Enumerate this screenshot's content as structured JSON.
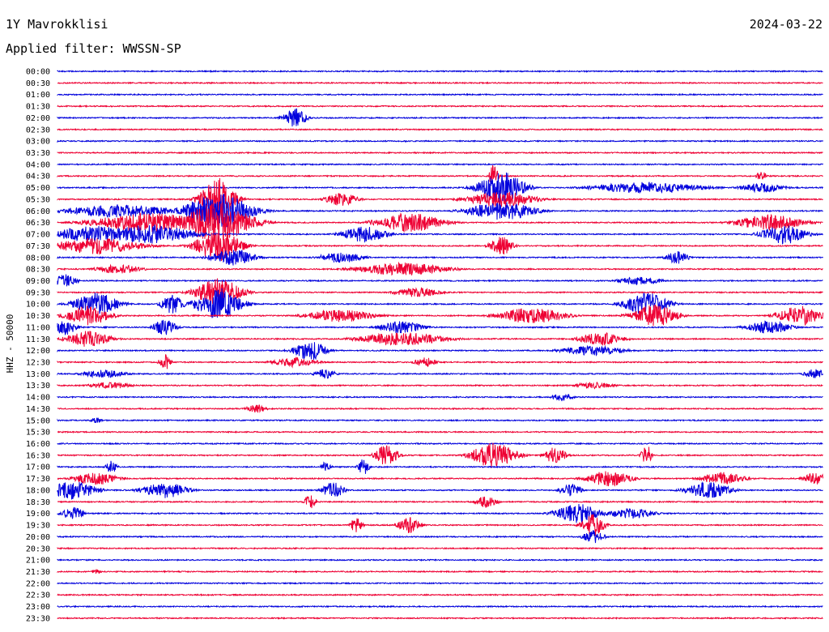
{
  "header": {
    "station": "1Y Mavrokklisi",
    "date": "2024-03-22",
    "filter_text": "Applied filter: WWSSN-SP"
  },
  "chart_data": {
    "type": "line",
    "title": "1Y Mavrokklisi",
    "ylabel": "HHZ - 50000",
    "grid": false,
    "colors": {
      "even": "#0000dd",
      "odd": "#ee0033"
    },
    "rows": [
      {
        "label": "00:00",
        "bursts": []
      },
      {
        "label": "00:30",
        "bursts": []
      },
      {
        "label": "01:00",
        "bursts": []
      },
      {
        "label": "01:30",
        "bursts": []
      },
      {
        "label": "02:00",
        "bursts": [
          [
            0.31,
            12,
            0.01
          ]
        ]
      },
      {
        "label": "02:30",
        "bursts": []
      },
      {
        "label": "03:00",
        "bursts": []
      },
      {
        "label": "03:30",
        "bursts": []
      },
      {
        "label": "04:00",
        "bursts": []
      },
      {
        "label": "04:30",
        "bursts": [
          [
            0.57,
            15,
            0.004
          ],
          [
            0.92,
            8,
            0.004
          ]
        ]
      },
      {
        "label": "05:00",
        "bursts": [
          [
            0.58,
            20,
            0.02
          ],
          [
            0.77,
            7,
            0.05
          ],
          [
            0.92,
            6,
            0.02
          ]
        ]
      },
      {
        "label": "05:30",
        "bursts": [
          [
            0.21,
            28,
            0.015
          ],
          [
            0.37,
            8,
            0.015
          ],
          [
            0.58,
            10,
            0.03
          ]
        ]
      },
      {
        "label": "06:00",
        "bursts": [
          [
            0.08,
            8,
            0.05
          ],
          [
            0.21,
            22,
            0.03
          ],
          [
            0.58,
            12,
            0.03
          ]
        ]
      },
      {
        "label": "06:30",
        "bursts": [
          [
            0.12,
            12,
            0.05
          ],
          [
            0.21,
            26,
            0.03
          ],
          [
            0.46,
            12,
            0.03
          ],
          [
            0.93,
            10,
            0.03
          ]
        ]
      },
      {
        "label": "07:00",
        "bursts": [
          [
            0.05,
            10,
            0.04
          ],
          [
            0.12,
            12,
            0.04
          ],
          [
            0.4,
            10,
            0.02
          ],
          [
            0.95,
            12,
            0.02
          ]
        ]
      },
      {
        "label": "07:30",
        "bursts": [
          [
            0.05,
            10,
            0.04
          ],
          [
            0.21,
            20,
            0.02
          ],
          [
            0.58,
            12,
            0.01
          ]
        ]
      },
      {
        "label": "08:00",
        "bursts": [
          [
            0.23,
            10,
            0.02
          ],
          [
            0.37,
            7,
            0.02
          ],
          [
            0.81,
            8,
            0.01
          ]
        ]
      },
      {
        "label": "08:30",
        "bursts": [
          [
            0.08,
            6,
            0.02
          ],
          [
            0.45,
            8,
            0.04
          ]
        ]
      },
      {
        "label": "09:00",
        "bursts": [
          [
            0.01,
            8,
            0.01
          ],
          [
            0.76,
            5,
            0.02
          ]
        ]
      },
      {
        "label": "09:30",
        "bursts": [
          [
            0.21,
            18,
            0.02
          ],
          [
            0.47,
            6,
            0.02
          ]
        ]
      },
      {
        "label": "10:00",
        "bursts": [
          [
            0.05,
            14,
            0.02
          ],
          [
            0.15,
            12,
            0.01
          ],
          [
            0.21,
            20,
            0.02
          ],
          [
            0.77,
            14,
            0.02
          ]
        ]
      },
      {
        "label": "10:30",
        "bursts": [
          [
            0.04,
            12,
            0.02
          ],
          [
            0.37,
            8,
            0.03
          ],
          [
            0.62,
            10,
            0.03
          ],
          [
            0.78,
            14,
            0.02
          ],
          [
            0.97,
            12,
            0.02
          ]
        ]
      },
      {
        "label": "11:00",
        "bursts": [
          [
            0.01,
            10,
            0.01
          ],
          [
            0.14,
            10,
            0.01
          ],
          [
            0.45,
            8,
            0.02
          ],
          [
            0.93,
            8,
            0.02
          ]
        ]
      },
      {
        "label": "11:30",
        "bursts": [
          [
            0.04,
            10,
            0.02
          ],
          [
            0.45,
            8,
            0.04
          ],
          [
            0.71,
            8,
            0.02
          ]
        ]
      },
      {
        "label": "12:00",
        "bursts": [
          [
            0.33,
            12,
            0.015
          ],
          [
            0.7,
            6,
            0.03
          ]
        ]
      },
      {
        "label": "12:30",
        "bursts": [
          [
            0.14,
            10,
            0.005
          ],
          [
            0.31,
            6,
            0.02
          ],
          [
            0.48,
            6,
            0.01
          ]
        ]
      },
      {
        "label": "13:00",
        "bursts": [
          [
            0.06,
            5,
            0.02
          ],
          [
            0.35,
            6,
            0.01
          ],
          [
            0.99,
            6,
            0.01
          ]
        ]
      },
      {
        "label": "13:30",
        "bursts": [
          [
            0.07,
            4,
            0.02
          ],
          [
            0.7,
            4,
            0.02
          ]
        ]
      },
      {
        "label": "14:00",
        "bursts": [
          [
            0.66,
            5,
            0.01
          ]
        ]
      },
      {
        "label": "14:30",
        "bursts": [
          [
            0.26,
            5,
            0.01
          ]
        ]
      },
      {
        "label": "15:00",
        "bursts": [
          [
            0.05,
            4,
            0.005
          ]
        ]
      },
      {
        "label": "15:30",
        "bursts": []
      },
      {
        "label": "16:00",
        "bursts": []
      },
      {
        "label": "16:30",
        "bursts": [
          [
            0.43,
            14,
            0.01
          ],
          [
            0.57,
            16,
            0.02
          ],
          [
            0.65,
            10,
            0.01
          ],
          [
            0.77,
            12,
            0.005
          ]
        ]
      },
      {
        "label": "17:00",
        "bursts": [
          [
            0.07,
            8,
            0.005
          ],
          [
            0.4,
            10,
            0.005
          ],
          [
            0.35,
            6,
            0.005
          ]
        ]
      },
      {
        "label": "17:30",
        "bursts": [
          [
            0.05,
            8,
            0.02
          ],
          [
            0.72,
            10,
            0.02
          ],
          [
            0.87,
            8,
            0.02
          ],
          [
            0.99,
            8,
            0.01
          ]
        ]
      },
      {
        "label": "18:00",
        "bursts": [
          [
            0.02,
            12,
            0.02
          ],
          [
            0.14,
            10,
            0.02
          ],
          [
            0.36,
            10,
            0.01
          ],
          [
            0.67,
            8,
            0.01
          ],
          [
            0.85,
            10,
            0.02
          ]
        ]
      },
      {
        "label": "18:30",
        "bursts": [
          [
            0.33,
            10,
            0.005
          ],
          [
            0.56,
            7,
            0.01
          ]
        ]
      },
      {
        "label": "19:00",
        "bursts": [
          [
            0.02,
            8,
            0.01
          ],
          [
            0.68,
            12,
            0.02
          ],
          [
            0.75,
            7,
            0.02
          ]
        ]
      },
      {
        "label": "19:30",
        "bursts": [
          [
            0.39,
            10,
            0.005
          ],
          [
            0.46,
            10,
            0.01
          ],
          [
            0.7,
            14,
            0.01
          ]
        ]
      },
      {
        "label": "20:00",
        "bursts": [
          [
            0.7,
            8,
            0.01
          ]
        ]
      },
      {
        "label": "20:30",
        "bursts": []
      },
      {
        "label": "21:00",
        "bursts": []
      },
      {
        "label": "21:30",
        "bursts": [
          [
            0.05,
            3,
            0.005
          ]
        ]
      },
      {
        "label": "22:00",
        "bursts": []
      },
      {
        "label": "22:30",
        "bursts": []
      },
      {
        "label": "23:00",
        "bursts": []
      },
      {
        "label": "23:30",
        "bursts": []
      }
    ]
  }
}
